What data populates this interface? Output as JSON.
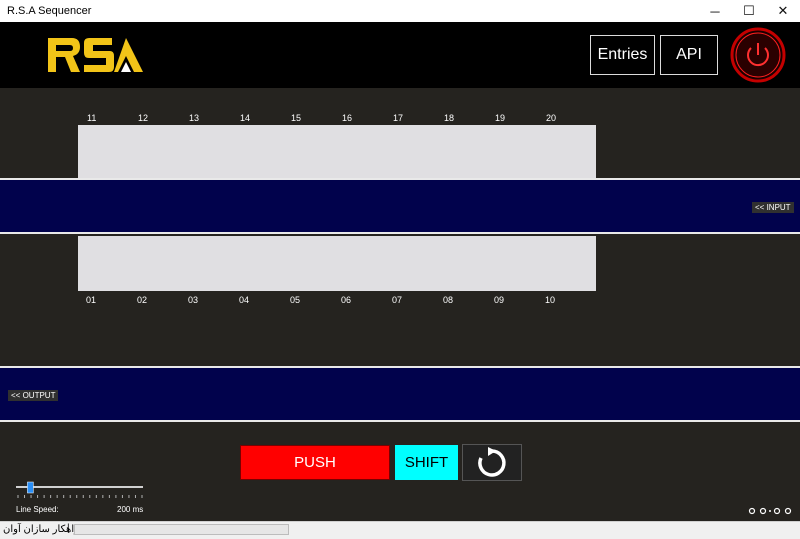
{
  "window": {
    "title": "R.S.A Sequencer",
    "controls": {
      "minimize": "─",
      "maximize": "☐",
      "close": "✕"
    }
  },
  "header": {
    "logo_text": "RSA",
    "buttons": {
      "entries": "Entries",
      "api": "API"
    },
    "power_icon": "power-icon"
  },
  "sequencer": {
    "top_numbers": [
      "11",
      "12",
      "13",
      "14",
      "15",
      "16",
      "17",
      "18",
      "19",
      "20"
    ],
    "bottom_numbers": [
      "01",
      "02",
      "03",
      "04",
      "05",
      "06",
      "07",
      "08",
      "09",
      "10"
    ],
    "input_label": "<< INPUT",
    "output_label": "<< OUTPUT"
  },
  "controls": {
    "push_label": "PUSH",
    "shift_label": "SHIFT",
    "reset_icon": "refresh-icon"
  },
  "speed": {
    "label": "Line Speed:",
    "value": "200 ms",
    "slider_value_fraction": 0.1
  },
  "status": {
    "text": "راهکار سازان آوان",
    "separator": "|"
  },
  "colors": {
    "background": "#25231f",
    "header": "#000000",
    "lane": "#01024c",
    "panel": "#e0dfe2",
    "push": "#ff0000",
    "shift": "#00ffff",
    "logo": "#f2c418"
  }
}
